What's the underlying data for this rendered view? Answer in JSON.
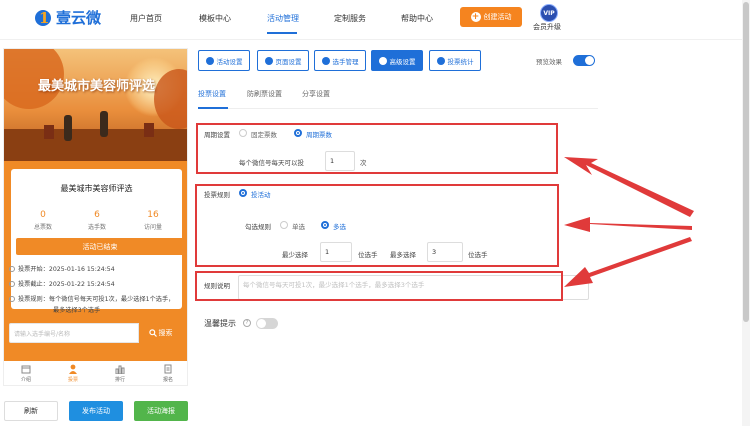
{
  "brand": {
    "name": "壹云微"
  },
  "nav": {
    "items": [
      "用户首页",
      "模板中心",
      "活动管理",
      "定制服务",
      "帮助中心"
    ],
    "create_label": "创建活动",
    "vip_badge": "VIP",
    "vip_label": "会员升级"
  },
  "preview": {
    "banner_title": "最美城市美容师评选",
    "card_title": "最美城市美容师评选",
    "stats": [
      {
        "value": "0",
        "label": "总票数"
      },
      {
        "value": "6",
        "label": "选手数"
      },
      {
        "value": "16",
        "label": "访问量"
      }
    ],
    "ended_label": "活动已结束",
    "info": [
      "投票开始：2025-01-16 15:24:54",
      "投票截止：2025-01-22 15:24:54",
      "投票规则：每个微信号每天可投1次，最少选择1个选手，",
      "最多选择3个选手"
    ],
    "search_placeholder": "请输入选手编号/名称",
    "search_label": "搜索",
    "bottom_tabs": [
      "介绍",
      "投票",
      "排行",
      "报名"
    ]
  },
  "bottom_buttons": {
    "refresh": "刷新",
    "publish": "发布活动",
    "poster": "活动海报"
  },
  "toolbar": {
    "buttons": [
      "活动设置",
      "页面设置",
      "选手管理",
      "高级设置",
      "投票统计"
    ],
    "preview_label": "预览效果"
  },
  "subtabs": [
    "投票设置",
    "防刷票设置",
    "分享设置"
  ],
  "period": {
    "label": "周期设置",
    "options": [
      "固定票数",
      "周期票数"
    ],
    "selected": "周期票数",
    "prefix": "每个微信号每天可以投",
    "value": "1",
    "suffix": "次"
  },
  "rule": {
    "label": "投票规则",
    "option": "投活动",
    "check_label": "勾选规则",
    "check_options": [
      "单选",
      "多选"
    ],
    "check_selected": "多选",
    "min_label": "最少选择",
    "min_value": "1",
    "min_unit": "位选手",
    "max_label": "最多选择",
    "max_value": "3",
    "max_unit": "位选手"
  },
  "description": {
    "label": "规则说明",
    "placeholder": "每个微信号每天可投1次，最少选择1个选手，最多选择3个选手"
  },
  "tips": {
    "label": "温馨提示",
    "icon_glyph": "?"
  },
  "colors": {
    "primary": "#1f6fd8",
    "accent": "#f08a26",
    "annotation": "#e03a3a",
    "green": "#52b54b"
  }
}
